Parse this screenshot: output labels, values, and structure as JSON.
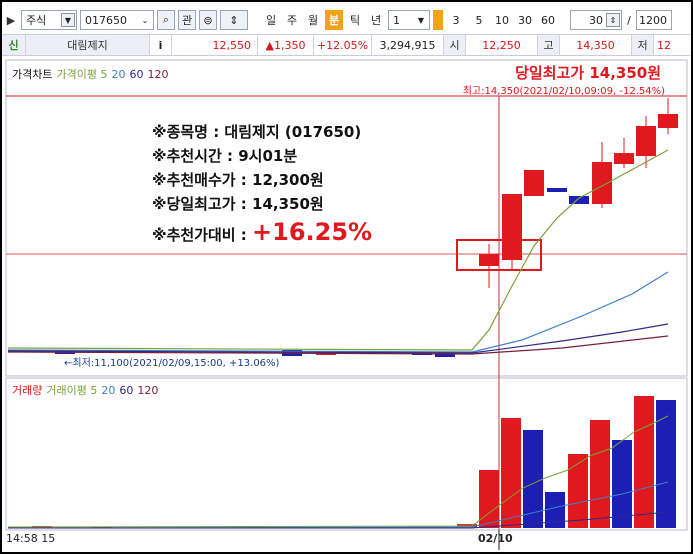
{
  "toolbar": {
    "market": "주식",
    "code": "017650",
    "btn_gwan": "관",
    "periods": [
      "일",
      "주",
      "월",
      "분",
      "틱",
      "년"
    ],
    "active_period": "분",
    "interval_value": "1",
    "minute_choices": [
      "3",
      "5",
      "10",
      "30",
      "60"
    ],
    "count_value": "30",
    "slash": "/",
    "total_value": "1200"
  },
  "quote": {
    "flag": "신",
    "name": "대림제지",
    "info_btn": "i",
    "price": "12,550",
    "change": "▲1,350",
    "change_pct": "+12.05%",
    "volume": "3,294,915",
    "open_label": "시",
    "open": "12,250",
    "high_label": "고",
    "high": "14,350",
    "low_label": "저",
    "low": "12"
  },
  "price_chart": {
    "legend": [
      "가격차트",
      "가격이평 5",
      "20",
      "60",
      "120"
    ],
    "high_title": "당일최고가 14,350원",
    "high_note": "최고:14,350(2021/02/10,09:09, -12.54%)",
    "low_note": "←최저:11,100(2021/02/09,15:00, +13.06%)",
    "annotation": {
      "line1": "※종목명 : 대림제지 (017650)",
      "line2": "※추천시간 : 9시01분",
      "line3": "※추천매수가 : 12,300원",
      "line4": "※당일최고가 : 14,350원",
      "line5_label": "※추천가대비 : ",
      "line5_value": "+16.25%"
    }
  },
  "volume_chart": {
    "legend": [
      "거래량",
      "거래이평 5",
      "20",
      "60",
      "120"
    ]
  },
  "axis": {
    "time": "14:58  15",
    "date": "02/10"
  },
  "colors": {
    "up": "#e0191f",
    "down": "#1d1fb4",
    "ma5": "#7aa13a",
    "ma20": "#3f7fc6",
    "ma60": "#2e2a88",
    "ma120": "#7a1e3f",
    "accent": "#f2a31b"
  }
}
